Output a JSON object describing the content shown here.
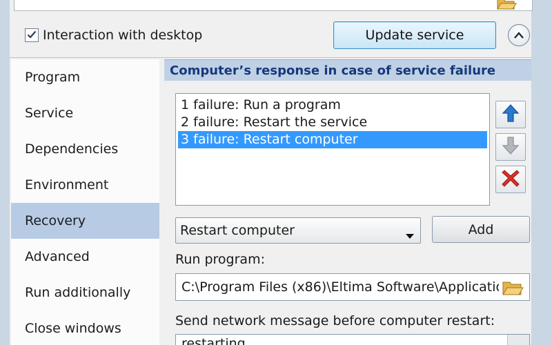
{
  "options": {
    "interaction_checkbox_label": "Interaction with desktop",
    "interaction_checked": true,
    "update_button_label": "Update service"
  },
  "sidebar": {
    "items": [
      {
        "label": "Program"
      },
      {
        "label": "Service"
      },
      {
        "label": "Dependencies"
      },
      {
        "label": "Environment"
      },
      {
        "label": "Recovery",
        "selected": true
      },
      {
        "label": "Advanced"
      },
      {
        "label": "Run additionally"
      },
      {
        "label": "Close windows"
      }
    ]
  },
  "recovery": {
    "title": "Computer’s response in case of service failure",
    "failures": [
      {
        "text": "1 failure: Run a program"
      },
      {
        "text": "2 failure: Restart the service"
      },
      {
        "text": "3 failure: Restart computer",
        "selected": true
      }
    ],
    "action_select_value": "Restart computer",
    "add_button_label": "Add",
    "run_program_label": "Run program:",
    "run_program_value": "C:\\Program Files (x86)\\Eltima Software\\Applicatio",
    "send_message_label": "Send network message before computer restart:",
    "send_message_value": "restarting"
  },
  "icons": {
    "checkbox": "checkmark-icon",
    "collapse": "chevron-up-icon",
    "move_up": "arrow-up-icon",
    "move_down": "arrow-down-icon",
    "delete": "delete-x-icon",
    "browse": "folder-open-icon",
    "dropdown": "dropdown-arrow-icon"
  },
  "colors": {
    "header_band": "#c0d1e6",
    "header_text": "#15397a",
    "sidebar_selected": "#b7cbe5",
    "list_selection": "#3399ff",
    "delete_red": "#d9302a",
    "arrow_blue": "#2a78d0"
  }
}
